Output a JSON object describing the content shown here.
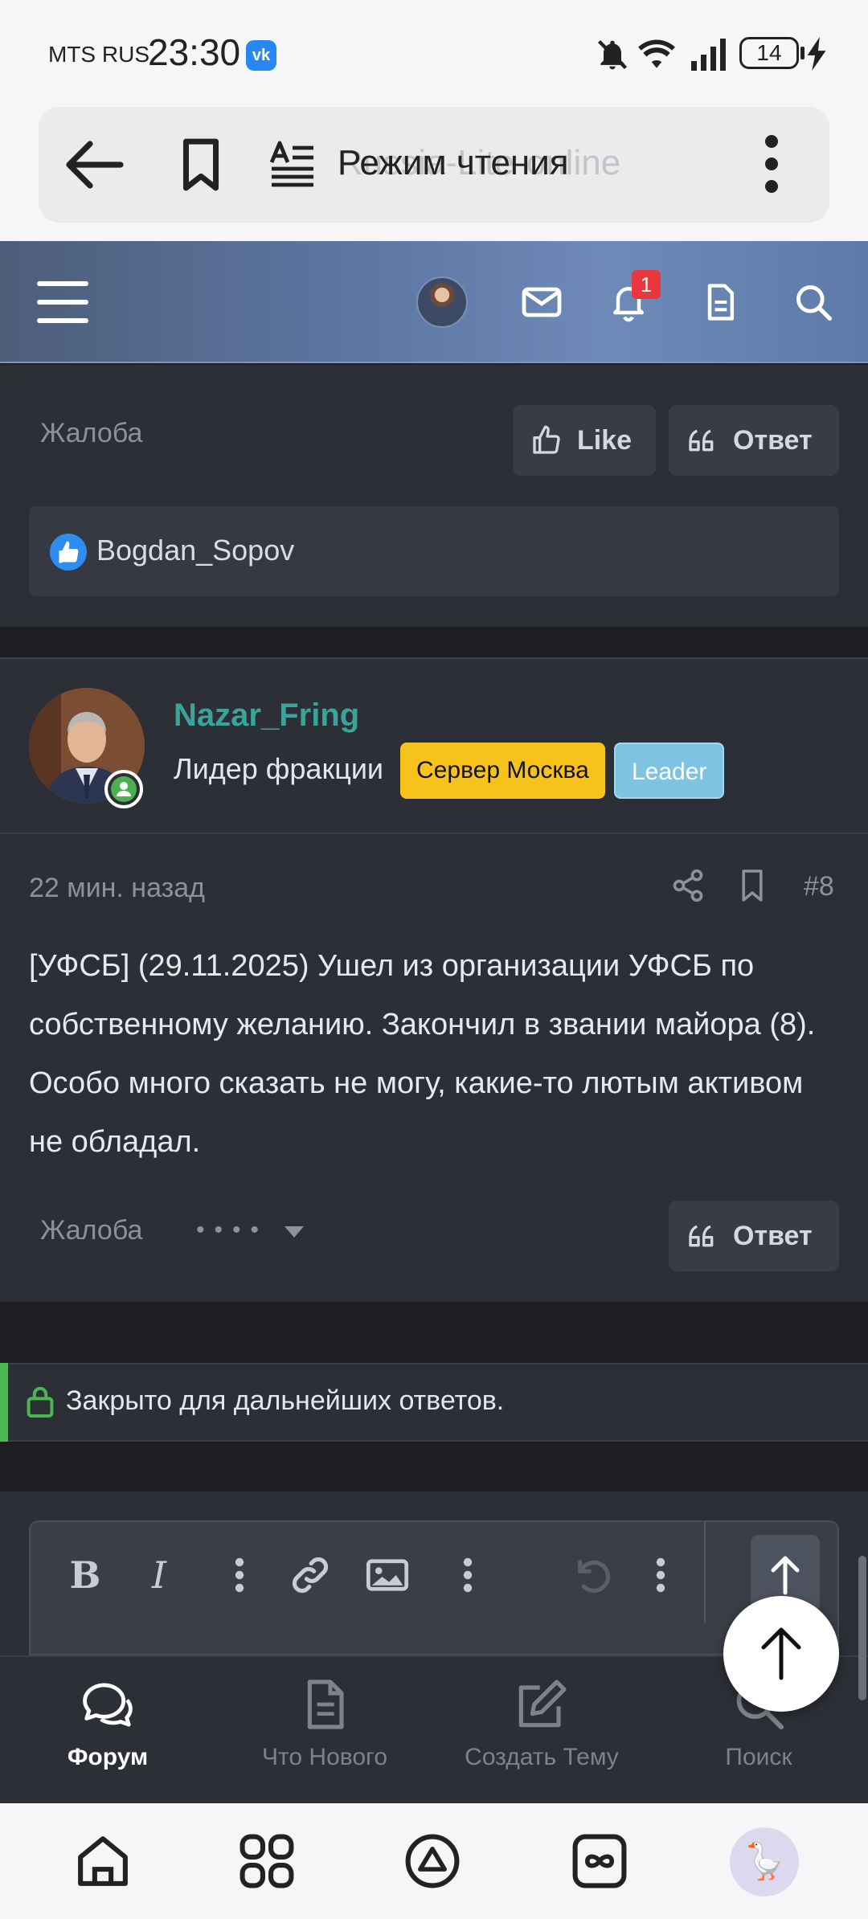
{
  "status_bar": {
    "carrier": "MTS RUS",
    "time": "23:30",
    "battery": "14",
    "app_icon": "vk-icon"
  },
  "browser": {
    "url_ghost": "Russia-Lite-online",
    "reader_mode_label": "Режим чтения",
    "icons": [
      "back-arrow-icon",
      "bookmark-icon",
      "reader-mode-icon",
      "more-vertical-icon"
    ]
  },
  "forum_header": {
    "notification_count": "1",
    "icons": [
      "hamburger-menu-icon",
      "avatar",
      "mail-icon",
      "bell-icon",
      "document-icon",
      "search-icon"
    ]
  },
  "post_prev": {
    "report_label": "Жалоба",
    "like_label": "Like",
    "reply_label": "Ответ",
    "reaction_user": "Bogdan_Sopov"
  },
  "post": {
    "username": "Nazar_Fring",
    "user_title": "Лидер фракции",
    "badges": [
      "Сервер Москва",
      "Leader"
    ],
    "badge_colors": {
      "server": "#f6c21b",
      "leader": "#7ec4e2"
    },
    "time": "22 мин. назад",
    "number": "#8",
    "text": "[УФСБ] (29.11.2025) Ушел из организации УФСБ по собственному желанию. Закончил в звании майора (8). Особо много сказать не могу, какие-то лютым активом не обладал.",
    "report_label": "Жалоба",
    "reply_label": "Ответ"
  },
  "thread_notice": {
    "text": "Закрыто для дальнейших ответов."
  },
  "editor": {
    "tools": [
      "bold-icon",
      "italic-icon",
      "more-vertical-icon",
      "link-icon",
      "image-icon",
      "more-vertical-icon",
      "undo-icon",
      "more-vertical-icon",
      "upload-icon"
    ]
  },
  "bottom_nav": {
    "items": [
      {
        "label": "Форум",
        "icon": "chat-bubbles-icon",
        "active": true
      },
      {
        "label": "Что Нового",
        "icon": "document-icon",
        "active": false
      },
      {
        "label": "Создать Тему",
        "icon": "edit-icon",
        "active": false
      },
      {
        "label": "Поиск",
        "icon": "search-icon",
        "active": false
      }
    ]
  },
  "accent_colors": {
    "username": "#3aa39a",
    "online": "#4caf50",
    "closed_accent": "#4bb84f",
    "notification": "#e8373d"
  }
}
